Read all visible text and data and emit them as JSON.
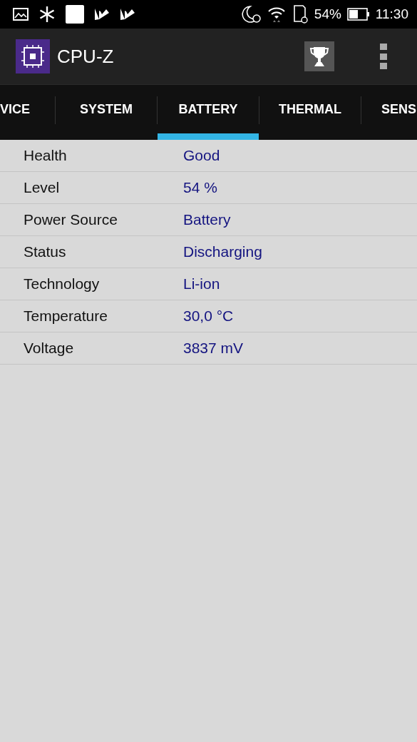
{
  "status_bar": {
    "battery_percent": "54%",
    "time": "11:30"
  },
  "app_bar": {
    "title": "CPU-Z"
  },
  "tabs": [
    {
      "label": "VICE",
      "selected": false
    },
    {
      "label": "SYSTEM",
      "selected": false
    },
    {
      "label": "BATTERY",
      "selected": true
    },
    {
      "label": "THERMAL",
      "selected": false
    },
    {
      "label": "SENS",
      "selected": false
    }
  ],
  "rows": [
    {
      "label": "Health",
      "value": "Good"
    },
    {
      "label": "Level",
      "value": "54 %"
    },
    {
      "label": "Power Source",
      "value": "Battery"
    },
    {
      "label": "Status",
      "value": "Discharging"
    },
    {
      "label": "Technology",
      "value": "Li-ion"
    },
    {
      "label": "Temperature",
      "value": "30,0 °C"
    },
    {
      "label": "Voltage",
      "value": "3837 mV"
    }
  ]
}
